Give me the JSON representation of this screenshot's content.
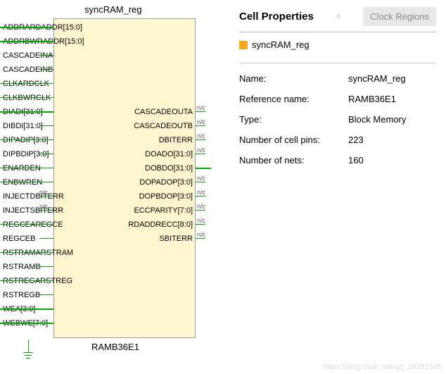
{
  "cell": {
    "title": "syncRAM_reg",
    "footer": "RAMB36E1",
    "swatch_color": "#f5a623",
    "tag": "syncRAM_reg"
  },
  "ports_left": [
    "ADDRARDADDR[15:0]",
    "ADDRBWRADDR[15:0]",
    "CASCADEINA",
    "CASCADEINB",
    "CLKARDCLK",
    "CLKBWRCLK",
    "DIADI[31:0]",
    "DIBDI[31:0]",
    "DIPADIP[3:0]",
    "DIPBDIP[3:0]",
    "ENARDEN",
    "ENBWREN",
    "INJECTDBITERR",
    "INJECTSBITERR",
    "REGCEAREGCE",
    "REGCEB",
    "RSTRAMARSTRAM",
    "RSTRAMB",
    "RSTREGARSTREG",
    "RSTREGB",
    "WEA[3:0]",
    "WEBWE[7:0]"
  ],
  "ports_right": [
    "CASCADEOUTA",
    "CASCADEOUTB",
    "DBITERR",
    "DOADO[31:0]",
    "DOBDO[31:0]",
    "DOPADOP[3:0]",
    "DOPBDOP[3:0]",
    "ECCPARITY[7:0]",
    "RDADDRECC[8:0]",
    "SBITERR"
  ],
  "nc_label": "n/c",
  "props": {
    "header": "Cell Properties",
    "tab": "Clock Regions",
    "rows": [
      {
        "label": "Name:",
        "value": "syncRAM_reg"
      },
      {
        "label": "Reference name:",
        "value": "RAMB36E1"
      },
      {
        "label": "Type:",
        "value": "Block Memory"
      },
      {
        "label": "Number of cell pins:",
        "value": "223"
      },
      {
        "label": "Number of nets:",
        "value": "160"
      }
    ]
  },
  "watermark": "https://blog.csdn.net/qq_34291505"
}
